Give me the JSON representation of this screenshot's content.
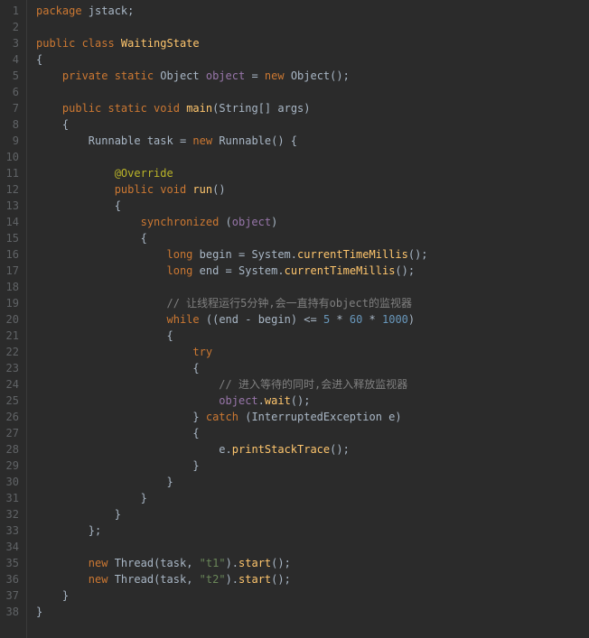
{
  "lines": [
    {
      "n": 1,
      "tokens": [
        {
          "c": "kw",
          "t": "package"
        },
        {
          "c": "",
          "t": " jstack"
        },
        {
          "c": "op",
          "t": ";"
        }
      ]
    },
    {
      "n": 2,
      "tokens": []
    },
    {
      "n": 3,
      "tokens": [
        {
          "c": "kw",
          "t": "public class "
        },
        {
          "c": "cls",
          "t": "WaitingState"
        }
      ]
    },
    {
      "n": 4,
      "tokens": [
        {
          "c": "op",
          "t": "{"
        }
      ]
    },
    {
      "n": 5,
      "tokens": [
        {
          "c": "",
          "t": "    "
        },
        {
          "c": "kw",
          "t": "private static "
        },
        {
          "c": "type",
          "t": "Object "
        },
        {
          "c": "field",
          "t": "object"
        },
        {
          "c": "",
          "t": " = "
        },
        {
          "c": "kw",
          "t": "new "
        },
        {
          "c": "type",
          "t": "Object"
        },
        {
          "c": "op",
          "t": "();"
        }
      ]
    },
    {
      "n": 6,
      "tokens": []
    },
    {
      "n": 7,
      "tokens": [
        {
          "c": "",
          "t": "    "
        },
        {
          "c": "kw",
          "t": "public static void "
        },
        {
          "c": "cls",
          "t": "main"
        },
        {
          "c": "op",
          "t": "("
        },
        {
          "c": "type",
          "t": "String"
        },
        {
          "c": "op",
          "t": "[] "
        },
        {
          "c": "var",
          "t": "args"
        },
        {
          "c": "op",
          "t": ")"
        }
      ]
    },
    {
      "n": 8,
      "tokens": [
        {
          "c": "",
          "t": "    "
        },
        {
          "c": "op",
          "t": "{"
        }
      ]
    },
    {
      "n": 9,
      "tokens": [
        {
          "c": "",
          "t": "        "
        },
        {
          "c": "type",
          "t": "Runnable "
        },
        {
          "c": "var",
          "t": "task"
        },
        {
          "c": "",
          "t": " = "
        },
        {
          "c": "kw",
          "t": "new "
        },
        {
          "c": "type",
          "t": "Runnable"
        },
        {
          "c": "op",
          "t": "() {"
        }
      ]
    },
    {
      "n": 10,
      "tokens": []
    },
    {
      "n": 11,
      "tokens": [
        {
          "c": "",
          "t": "            "
        },
        {
          "c": "ann",
          "t": "@Override"
        }
      ]
    },
    {
      "n": 12,
      "tokens": [
        {
          "c": "",
          "t": "            "
        },
        {
          "c": "kw",
          "t": "public void "
        },
        {
          "c": "cls",
          "t": "run"
        },
        {
          "c": "op",
          "t": "()"
        }
      ]
    },
    {
      "n": 13,
      "tokens": [
        {
          "c": "",
          "t": "            "
        },
        {
          "c": "op",
          "t": "{"
        }
      ]
    },
    {
      "n": 14,
      "tokens": [
        {
          "c": "",
          "t": "                "
        },
        {
          "c": "kw",
          "t": "synchronized "
        },
        {
          "c": "op",
          "t": "("
        },
        {
          "c": "field",
          "t": "object"
        },
        {
          "c": "op",
          "t": ")"
        }
      ]
    },
    {
      "n": 15,
      "tokens": [
        {
          "c": "",
          "t": "                "
        },
        {
          "c": "op",
          "t": "{"
        }
      ]
    },
    {
      "n": 16,
      "tokens": [
        {
          "c": "",
          "t": "                    "
        },
        {
          "c": "kw",
          "t": "long "
        },
        {
          "c": "var",
          "t": "begin"
        },
        {
          "c": "",
          "t": " = "
        },
        {
          "c": "type",
          "t": "System"
        },
        {
          "c": "op",
          "t": "."
        },
        {
          "c": "mth",
          "t": "currentTimeMillis"
        },
        {
          "c": "op",
          "t": "();"
        }
      ]
    },
    {
      "n": 17,
      "tokens": [
        {
          "c": "",
          "t": "                    "
        },
        {
          "c": "kw",
          "t": "long "
        },
        {
          "c": "var",
          "t": "end"
        },
        {
          "c": "",
          "t": " = "
        },
        {
          "c": "type",
          "t": "System"
        },
        {
          "c": "op",
          "t": "."
        },
        {
          "c": "mth",
          "t": "currentTimeMillis"
        },
        {
          "c": "op",
          "t": "();"
        }
      ]
    },
    {
      "n": 18,
      "tokens": []
    },
    {
      "n": 19,
      "tokens": [
        {
          "c": "",
          "t": "                    "
        },
        {
          "c": "cmt",
          "t": "// 让线程运行5分钟,会一直持有object的监视器"
        }
      ]
    },
    {
      "n": 20,
      "tokens": [
        {
          "c": "",
          "t": "                    "
        },
        {
          "c": "kw",
          "t": "while "
        },
        {
          "c": "op",
          "t": "(("
        },
        {
          "c": "var",
          "t": "end"
        },
        {
          "c": "",
          "t": " - "
        },
        {
          "c": "var",
          "t": "begin"
        },
        {
          "c": "op",
          "t": ") <= "
        },
        {
          "c": "num",
          "t": "5"
        },
        {
          "c": "",
          "t": " * "
        },
        {
          "c": "num",
          "t": "60"
        },
        {
          "c": "",
          "t": " * "
        },
        {
          "c": "num",
          "t": "1000"
        },
        {
          "c": "op",
          "t": ")"
        }
      ]
    },
    {
      "n": 21,
      "tokens": [
        {
          "c": "",
          "t": "                    "
        },
        {
          "c": "op",
          "t": "{"
        }
      ]
    },
    {
      "n": 22,
      "tokens": [
        {
          "c": "",
          "t": "                        "
        },
        {
          "c": "kw",
          "t": "try"
        }
      ]
    },
    {
      "n": 23,
      "tokens": [
        {
          "c": "",
          "t": "                        "
        },
        {
          "c": "op",
          "t": "{"
        }
      ]
    },
    {
      "n": 24,
      "tokens": [
        {
          "c": "",
          "t": "                            "
        },
        {
          "c": "cmt",
          "t": "// 进入等待的同时,会进入释放监视器"
        }
      ]
    },
    {
      "n": 25,
      "tokens": [
        {
          "c": "",
          "t": "                            "
        },
        {
          "c": "field",
          "t": "object"
        },
        {
          "c": "op",
          "t": "."
        },
        {
          "c": "mth",
          "t": "wait"
        },
        {
          "c": "op",
          "t": "();"
        }
      ]
    },
    {
      "n": 26,
      "tokens": [
        {
          "c": "",
          "t": "                        "
        },
        {
          "c": "op",
          "t": "} "
        },
        {
          "c": "kw",
          "t": "catch "
        },
        {
          "c": "op",
          "t": "("
        },
        {
          "c": "type",
          "t": "InterruptedException "
        },
        {
          "c": "var",
          "t": "e"
        },
        {
          "c": "op",
          "t": ")"
        }
      ]
    },
    {
      "n": 27,
      "tokens": [
        {
          "c": "",
          "t": "                        "
        },
        {
          "c": "op",
          "t": "{"
        }
      ]
    },
    {
      "n": 28,
      "tokens": [
        {
          "c": "",
          "t": "                            "
        },
        {
          "c": "var",
          "t": "e"
        },
        {
          "c": "op",
          "t": "."
        },
        {
          "c": "mth",
          "t": "printStackTrace"
        },
        {
          "c": "op",
          "t": "();"
        }
      ]
    },
    {
      "n": 29,
      "tokens": [
        {
          "c": "",
          "t": "                        "
        },
        {
          "c": "op",
          "t": "}"
        }
      ]
    },
    {
      "n": 30,
      "tokens": [
        {
          "c": "",
          "t": "                    "
        },
        {
          "c": "op",
          "t": "}"
        }
      ]
    },
    {
      "n": 31,
      "tokens": [
        {
          "c": "",
          "t": "                "
        },
        {
          "c": "op",
          "t": "}"
        }
      ]
    },
    {
      "n": 32,
      "tokens": [
        {
          "c": "",
          "t": "            "
        },
        {
          "c": "op",
          "t": "}"
        }
      ]
    },
    {
      "n": 33,
      "tokens": [
        {
          "c": "",
          "t": "        "
        },
        {
          "c": "op",
          "t": "};"
        }
      ]
    },
    {
      "n": 34,
      "tokens": []
    },
    {
      "n": 35,
      "tokens": [
        {
          "c": "",
          "t": "        "
        },
        {
          "c": "kw",
          "t": "new "
        },
        {
          "c": "type",
          "t": "Thread"
        },
        {
          "c": "op",
          "t": "("
        },
        {
          "c": "var",
          "t": "task"
        },
        {
          "c": "op",
          "t": ", "
        },
        {
          "c": "str",
          "t": "\"t1\""
        },
        {
          "c": "op",
          "t": ")."
        },
        {
          "c": "mth",
          "t": "start"
        },
        {
          "c": "op",
          "t": "();"
        }
      ]
    },
    {
      "n": 36,
      "tokens": [
        {
          "c": "",
          "t": "        "
        },
        {
          "c": "kw",
          "t": "new "
        },
        {
          "c": "type",
          "t": "Thread"
        },
        {
          "c": "op",
          "t": "("
        },
        {
          "c": "var",
          "t": "task"
        },
        {
          "c": "op",
          "t": ", "
        },
        {
          "c": "str",
          "t": "\"t2\""
        },
        {
          "c": "op",
          "t": ")."
        },
        {
          "c": "mth",
          "t": "start"
        },
        {
          "c": "op",
          "t": "();"
        }
      ]
    },
    {
      "n": 37,
      "tokens": [
        {
          "c": "",
          "t": "    "
        },
        {
          "c": "op",
          "t": "}"
        }
      ]
    },
    {
      "n": 38,
      "tokens": [
        {
          "c": "op",
          "t": "}"
        }
      ]
    }
  ]
}
